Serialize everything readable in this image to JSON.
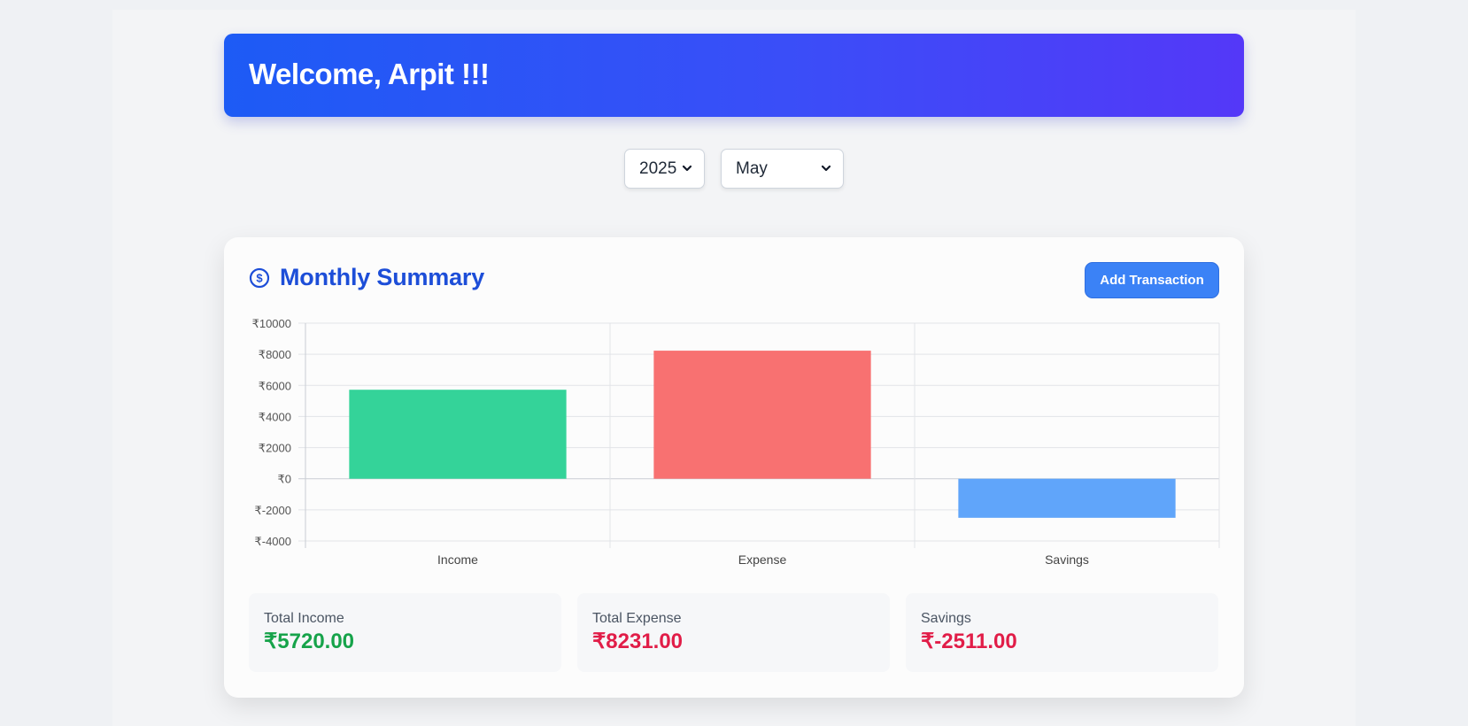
{
  "header": {
    "welcome_text": "Welcome, Arpit !!!"
  },
  "filters": {
    "year": "2025",
    "month": "May"
  },
  "summary": {
    "title": "Monthly Summary",
    "add_button_label": "Add Transaction",
    "stats": [
      {
        "label": "Total Income",
        "value": "₹5720.00",
        "color": "#16a34a"
      },
      {
        "label": "Total Expense",
        "value": "₹8231.00",
        "color": "#e11d48"
      },
      {
        "label": "Savings",
        "value": "₹-2511.00",
        "color": "#e11d48"
      }
    ]
  },
  "icons": {
    "summary_icon": "dollar-circle-icon",
    "select_chevron": "chevron-down-icon"
  },
  "chart_data": {
    "type": "bar",
    "categories": [
      "Income",
      "Expense",
      "Savings"
    ],
    "values": [
      5720,
      8231,
      -2511
    ],
    "colors": [
      "#34d399",
      "#f87171",
      "#60a5fa"
    ],
    "ylim": [
      -4000,
      10000
    ],
    "yticks": [
      10000,
      8000,
      6000,
      4000,
      2000,
      0,
      -2000,
      -4000
    ],
    "ytick_prefix": "₹",
    "grid": true,
    "legend": "none"
  }
}
